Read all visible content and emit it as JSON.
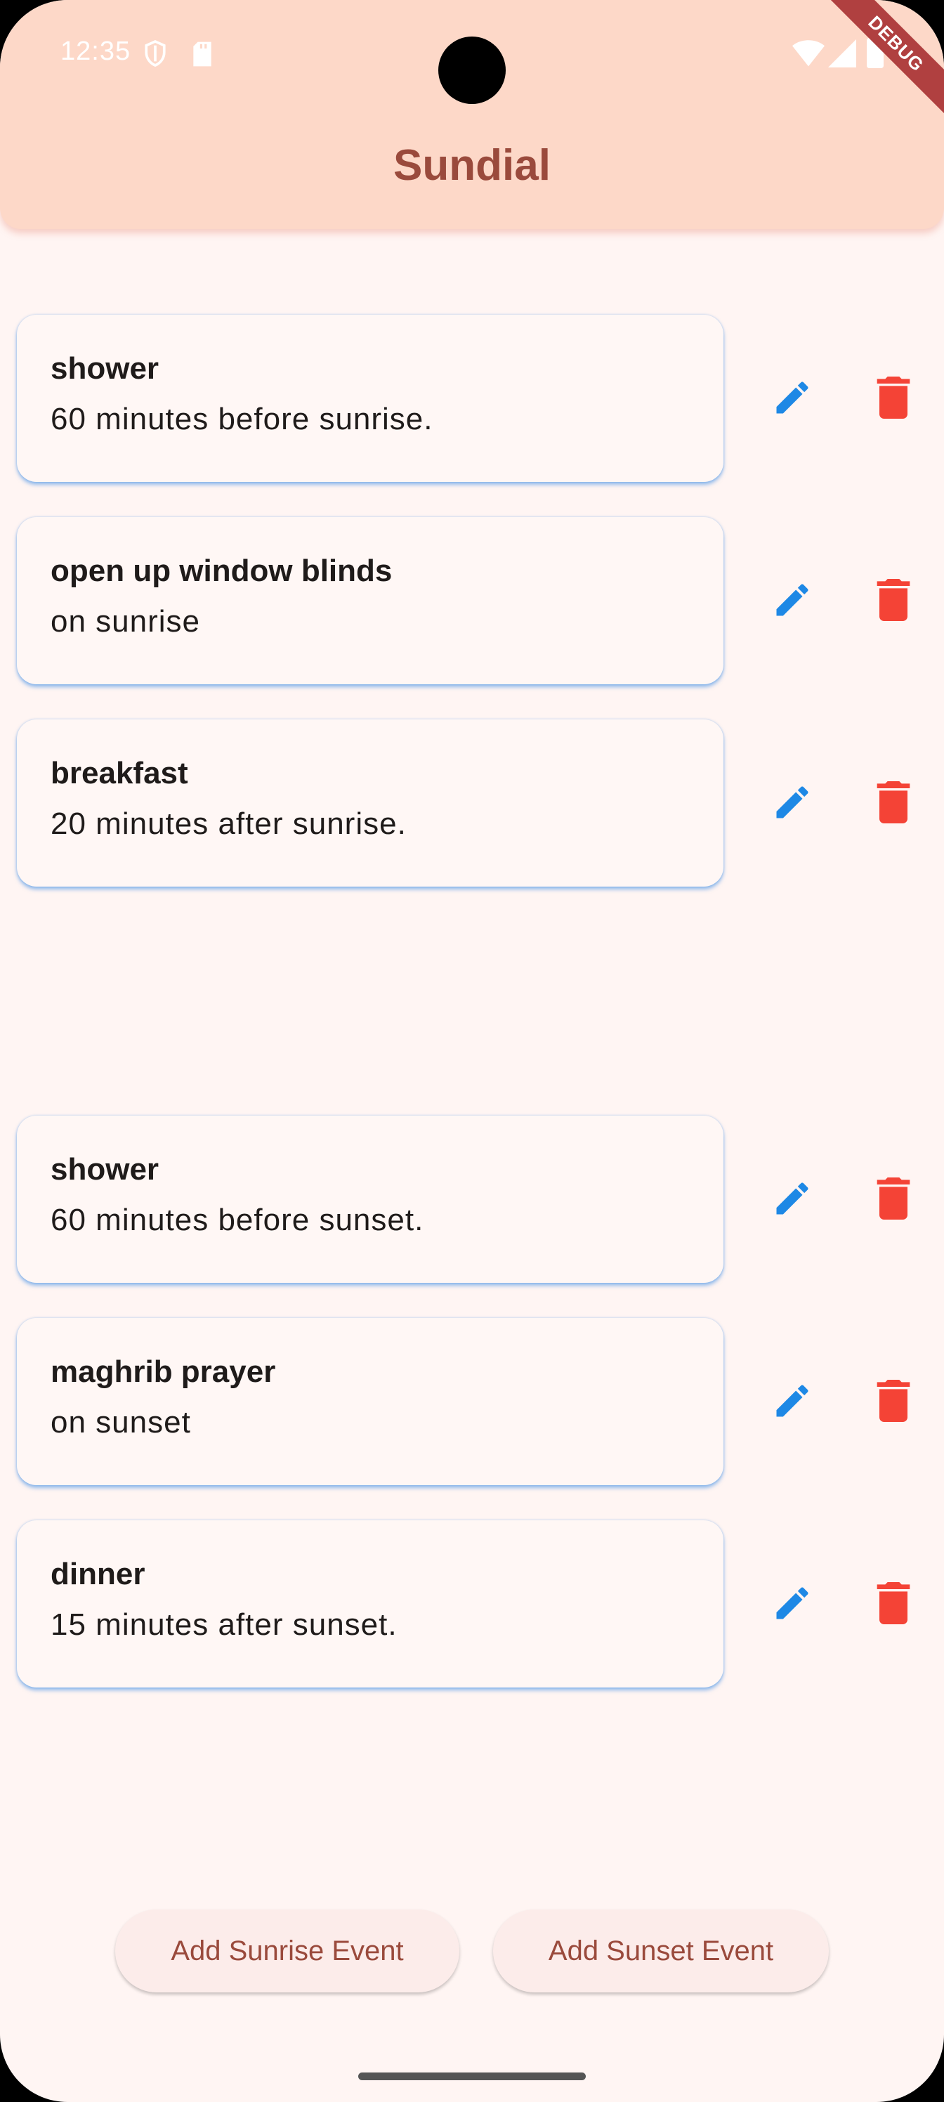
{
  "status_bar": {
    "time": "12:35",
    "icons": [
      "shield-icon",
      "sd-card-icon",
      "wifi-icon",
      "signal-icon",
      "battery-icon"
    ],
    "debug_label": "DEBUG"
  },
  "app_bar": {
    "title": "Sundial"
  },
  "sunrise_events": [
    {
      "name": "shower",
      "description": "60 minutes before sunrise."
    },
    {
      "name": "open up window blinds",
      "description": "on sunrise"
    },
    {
      "name": "breakfast",
      "description": "20 minutes after sunrise."
    }
  ],
  "sunset_events": [
    {
      "name": "shower",
      "description": "60 minutes before sunset."
    },
    {
      "name": "maghrib prayer",
      "description": "on sunset"
    },
    {
      "name": "dinner",
      "description": "15 minutes after sunset."
    }
  ],
  "actions": {
    "add_sunrise": "Add Sunrise Event",
    "add_sunset": "Add Sunset Event"
  },
  "colors": {
    "app_bar": "#fdd8c8",
    "background": "#fff5f3",
    "title": "#9a4a3c",
    "edit_icon": "#1e88e5",
    "delete_icon": "#f44336",
    "card_glow": "#3c8ce6"
  }
}
